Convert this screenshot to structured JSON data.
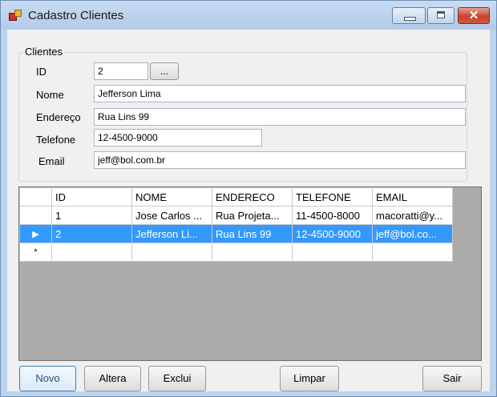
{
  "window": {
    "title": "Cadastro Clientes"
  },
  "groupbox": {
    "title": "Clientes"
  },
  "form": {
    "id": {
      "label": "ID",
      "value": "2",
      "lookup_label": "..."
    },
    "nome": {
      "label": "Nome",
      "value": "Jefferson Lima"
    },
    "endereco": {
      "label": "Endereço",
      "value": "Rua Lins 99"
    },
    "telefone": {
      "label": "Telefone",
      "value": "12-4500-9000"
    },
    "email": {
      "label": "Email",
      "value": "jeff@bol.com.br"
    }
  },
  "grid": {
    "columns": [
      "ID",
      "NOME",
      "ENDERECO",
      "TELEFONE",
      "EMAIL"
    ],
    "rows": [
      {
        "marker": "",
        "cells": [
          "1",
          "Jose Carlos ...",
          "Rua Projeta...",
          "11-4500-8000",
          "macoratti@y..."
        ]
      },
      {
        "marker": "▶",
        "cells": [
          "2",
          "Jefferson Li...",
          "Rua Lins 99",
          "12-4500-9000",
          "jeff@bol.co..."
        ]
      }
    ],
    "new_row_marker": "*"
  },
  "buttons": {
    "novo": "Novo",
    "altera": "Altera",
    "exclui": "Exclui",
    "limpar": "Limpar",
    "sair": "Sair"
  },
  "colors": {
    "selection": "#3399ff",
    "grid_background": "#ababab",
    "window_frame": "#bcd3ec"
  }
}
